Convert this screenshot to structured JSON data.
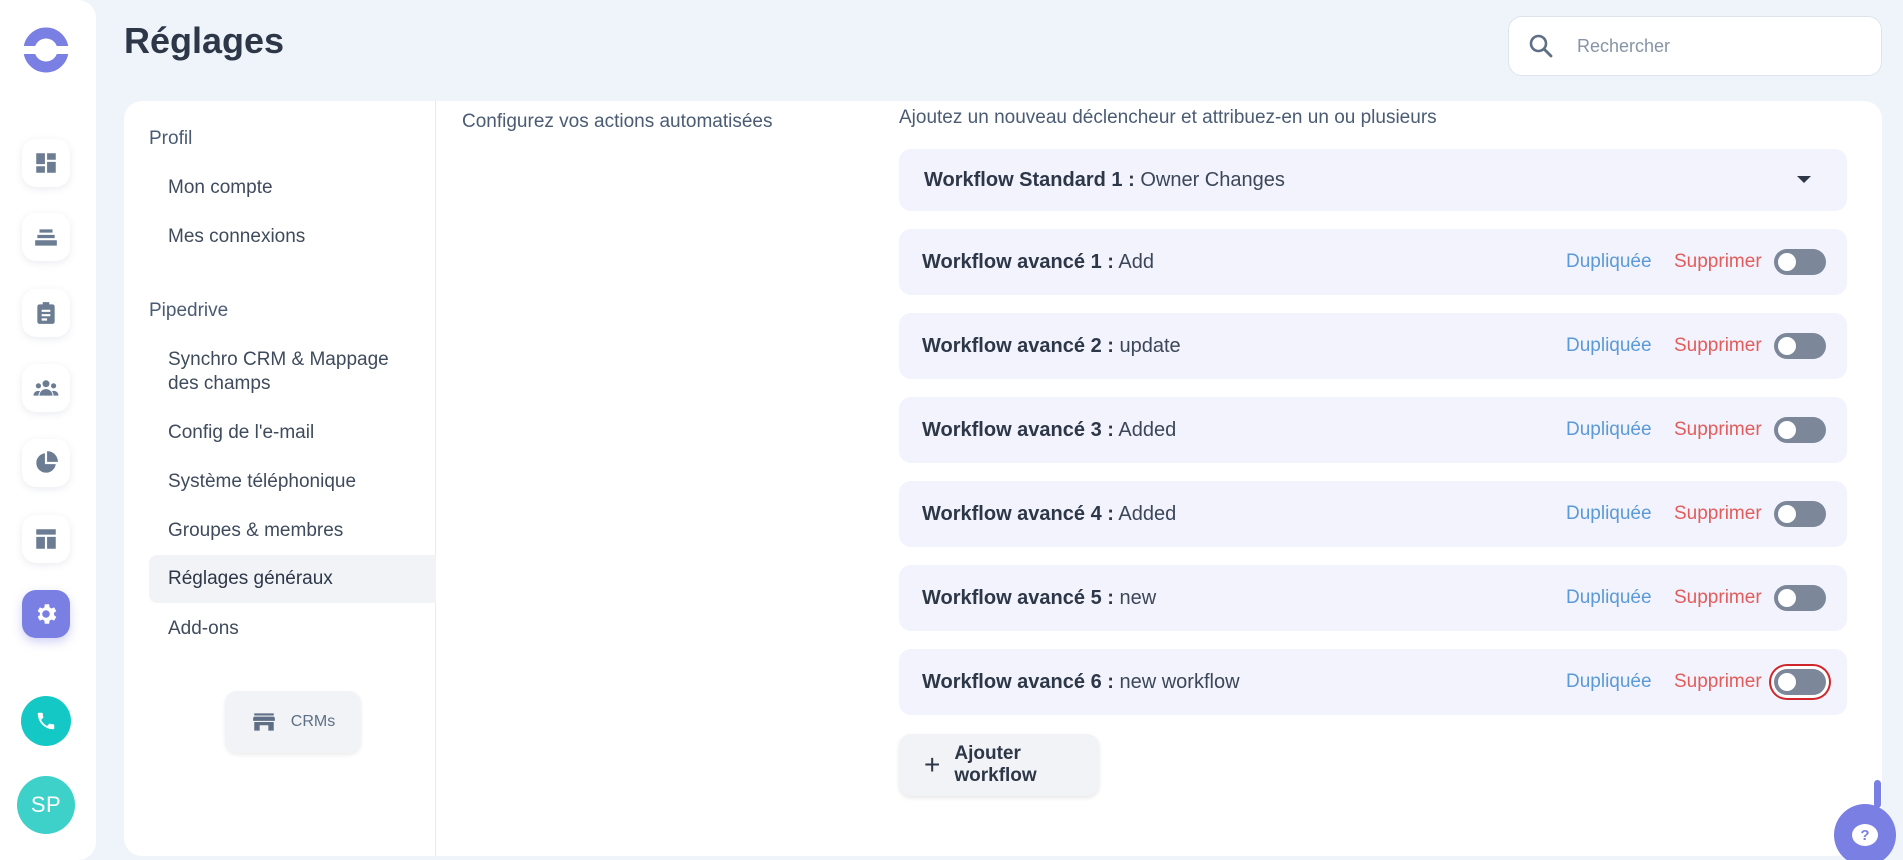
{
  "app": {
    "page_title": "Réglages",
    "accent_color": "#7a7fe3",
    "rail_icons": [
      "logo-icon",
      "dashboard-icon",
      "stack-icon",
      "clipboard-icon",
      "team-icon",
      "pie-chart-icon",
      "layout-icon",
      "gear-icon",
      "phone-icon"
    ]
  },
  "search": {
    "placeholder": "Rechercher",
    "value": ""
  },
  "user": {
    "initials": "SP"
  },
  "settings_nav": {
    "section_profile": "Profil",
    "my_account": "Mon compte",
    "my_connections": "Mes connexions",
    "section_pipedrive": "Pipedrive",
    "crm_sync": "Synchro CRM & Mappage des champs",
    "email_config": "Config de l'e-mail",
    "phone_system": "Système téléphonique",
    "groups_members": "Groupes & membres",
    "general_settings": "Réglages généraux",
    "addons": "Add-ons",
    "crms_button": "CRMs"
  },
  "main": {
    "description": "Configurez vos actions automatisées",
    "hint": "Ajoutez un nouveau déclencheur et attribuez-en un ou plusieurs",
    "standard_workflow": {
      "label": "Workflow Standard 1 :",
      "value": "Owner Changes"
    },
    "duplicate_label": "Dupliquée",
    "delete_label": "Supprimer",
    "advanced_workflows": [
      {
        "label": "Workflow avancé 1 :",
        "value": "Add",
        "enabled": false
      },
      {
        "label": "Workflow avancé 2 :",
        "value": "update",
        "enabled": false
      },
      {
        "label": "Workflow avancé 3 :",
        "value": "Added",
        "enabled": false
      },
      {
        "label": "Workflow avancé 4 :",
        "value": "Added",
        "enabled": false
      },
      {
        "label": "Workflow avancé 5 :",
        "value": "new",
        "enabled": false
      },
      {
        "label": "Workflow avancé 6 :",
        "value": "new workflow",
        "enabled": false
      }
    ],
    "add_workflow": "Ajouter workflow"
  },
  "help": {
    "label": "?"
  }
}
